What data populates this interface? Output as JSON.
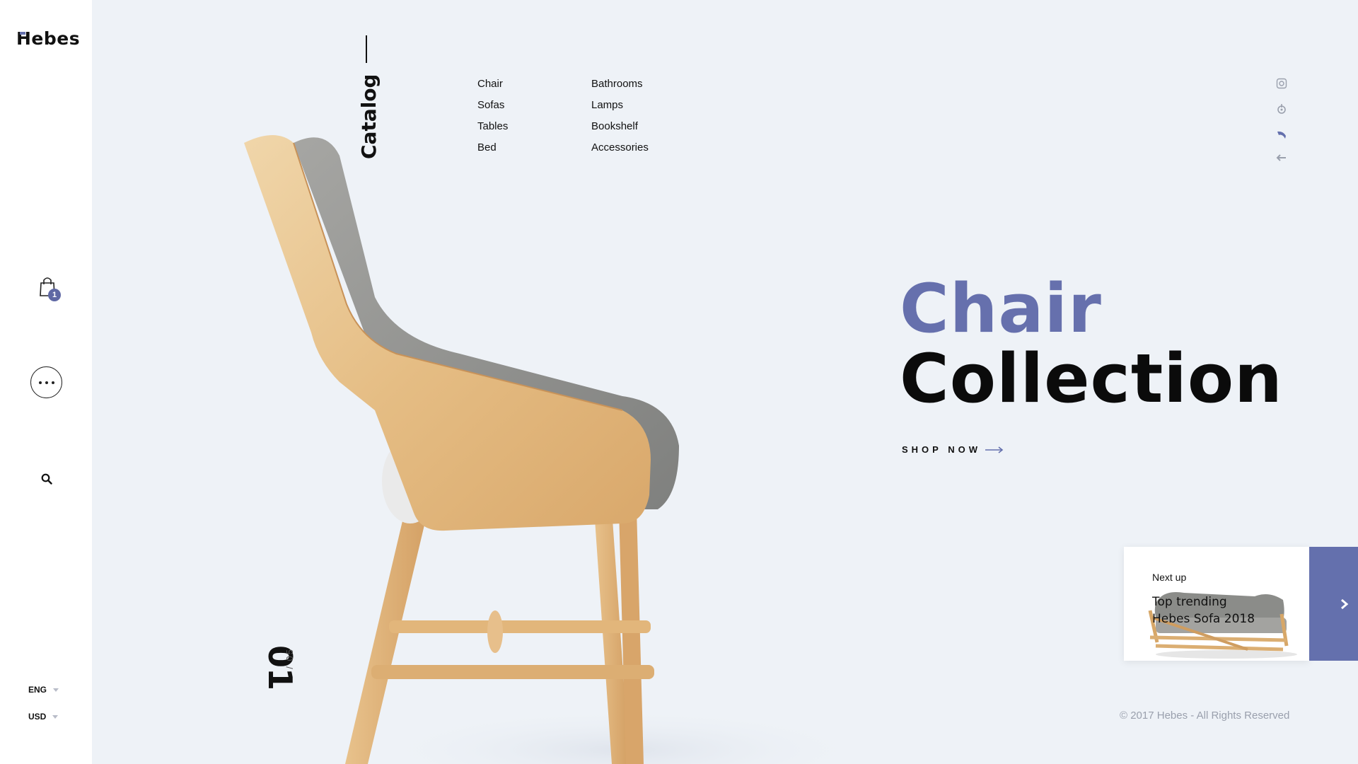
{
  "brand": {
    "name": "Hebes"
  },
  "sidebar": {
    "cart_count": "1",
    "language": "ENG",
    "currency": "USD"
  },
  "catalog": {
    "label": "Catalog"
  },
  "menu": {
    "column1": [
      "Chair",
      "Sofas",
      "Tables",
      "Bed"
    ],
    "column2": [
      "Bathrooms",
      "Lamps",
      "Bookshelf",
      "Accessories"
    ]
  },
  "socials": [
    "instagram-icon",
    "tripadvisor-icon",
    "dribbble-icon",
    "share-icon"
  ],
  "hero": {
    "line1": "Chair",
    "line2": "Collection",
    "cta": "SHOP NOW"
  },
  "next": {
    "label": "Next up",
    "title_line1": "Top trending",
    "title_line2": "Hebes Sofa 2018"
  },
  "slider": {
    "current": "01",
    "total": "/ 05"
  },
  "footer": {
    "copyright": "© 2017 Hebes - All Rights Reserved"
  },
  "colors": {
    "accent": "#6470ad",
    "background": "#eef2f7",
    "sidebar": "#ffffff",
    "text": "#0b0b0b"
  }
}
